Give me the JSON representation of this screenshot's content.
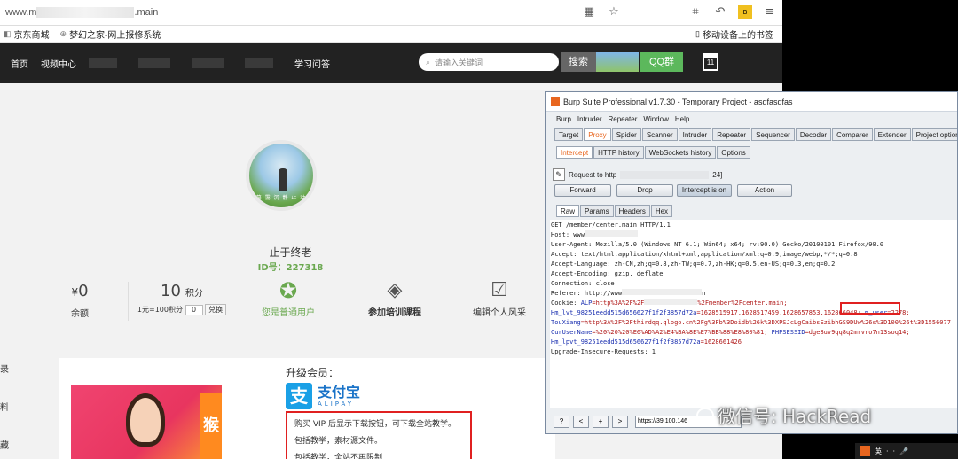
{
  "browser": {
    "url_start": "www.m",
    "url_end": ".main",
    "bookmarks": [
      "京东商城",
      "梦幻之家-网上报修系统"
    ],
    "mobile_bookmarks": "移动设备上的书签"
  },
  "site_nav": {
    "items": [
      "首页",
      "视频中心"
    ],
    "qa": "学习问答",
    "search_placeholder": "请输入关键词",
    "search_button": "搜索",
    "qq_button": "QQ群",
    "calendar_day": "11"
  },
  "profile": {
    "username": "止于终老",
    "user_id": "ID号：227318",
    "avatar_caption": "暮 霭 沉 静 止 动",
    "balance_value": "0",
    "balance_currency": "¥",
    "balance_label": "余额",
    "points_value": "10",
    "points_unit": "积分",
    "points_rate": "1元=100积分",
    "points_input": "0",
    "exchange_button": "兑换",
    "member_label": "您是普通用户",
    "training_label": "参加培训课程",
    "edit_label": "编辑个人风采"
  },
  "side_labels": [
    "录",
    "料",
    "藏"
  ],
  "vip": {
    "title": "升级会员：",
    "alipay_cn": "支付宝",
    "alipay_en": "ALIPAY",
    "desc": [
      "购买 VIP 后显示下载按钮，可下载全站教学。",
      "包括教学，素材源文件。",
      "包括教学，全站不再限制"
    ],
    "banner_text": "猴"
  },
  "burp": {
    "title": "Burp Suite Professional v1.7.30 - Temporary Project - asdfasdfas",
    "menu": [
      "Burp",
      "Intruder",
      "Repeater",
      "Window",
      "Help"
    ],
    "tabs": [
      "Target",
      "Proxy",
      "Spider",
      "Scanner",
      "Intruder",
      "Repeater",
      "Sequencer",
      "Decoder",
      "Comparer",
      "Extender",
      "Project options",
      "Us"
    ],
    "subtabs": [
      "Intercept",
      "HTTP history",
      "WebSockets history",
      "Options"
    ],
    "request_to": "Request to http",
    "request_to_end": "24]",
    "buttons": {
      "forward": "Forward",
      "drop": "Drop",
      "intercept": "Intercept is on",
      "action": "Action"
    },
    "view_tabs": [
      "Raw",
      "Params",
      "Headers",
      "Hex"
    ],
    "request_lines": [
      "GET /member/center.main HTTP/1.1",
      "Host: www",
      "User-Agent: Mozilla/5.0 (Windows NT 6.1; Win64; x64; rv:90.0) Gecko/20100101 Firefox/90.0",
      "Accept: text/html,application/xhtml+xml,application/xml;q=0.9,image/webp,*/*;q=0.8",
      "Accept-Language: zh-CN,zh;q=0.8,zh-TW;q=0.7,zh-HK;q=0.5,en-US;q=0.3,en;q=0.2",
      "Accept-Encoding: gzip, deflate",
      "Connection: close",
      "Referer: http://www"
    ],
    "referer_end": "n",
    "cookie_label": "Cookie: ",
    "cookie_alp_key": "ALP",
    "cookie_alp_val": "=http%3A%2F%2F",
    "cookie_alp_end": "%2Fmember%2Fcenter.main;",
    "cookie_hm_key": "Hm_lvt_98251eedd515d656627f1f2f3857d72a",
    "cookie_hm_val": "=1628515917,1628517459,1628657853,162866048",
    "cookie_muser_key": "m_user",
    "cookie_muser_val": "=2278;",
    "cookie_tou_key": "TouXiang",
    "cookie_tou_val": "=http%3A%2F%2Fthirdqq.qlogo.cn%2Fg%3Fb%3Doidb%26k%3DXPSJcLgCaibsEzibhGS9DUw%26s%3D100%26t%3D1556077",
    "cookie_cur_key": "CurUserName",
    "cookie_cur_val": "=%20%20%20%E6%AD%A2%E4%BA%8E%E7%BB%88%E8%80%81;",
    "cookie_php_key": "PHPSESSID",
    "cookie_php_val": "=dge8uv9qq8q2mrvro7n13soq14;",
    "cookie_hmp_key": "Hm_lpvt_98251eedd515d656627f1f2f3857d72a",
    "cookie_hmp_val": "=1628661426",
    "last_line": "Upgrade-Insecure-Requests: 1",
    "nav_buttons": [
      "?",
      "<",
      "+",
      ">"
    ],
    "bottom_url": "https://39.100.146"
  },
  "watermark": "微信号: HackRead",
  "taskbar": [
    "英",
    "·",
    "·",
    "🎤"
  ]
}
